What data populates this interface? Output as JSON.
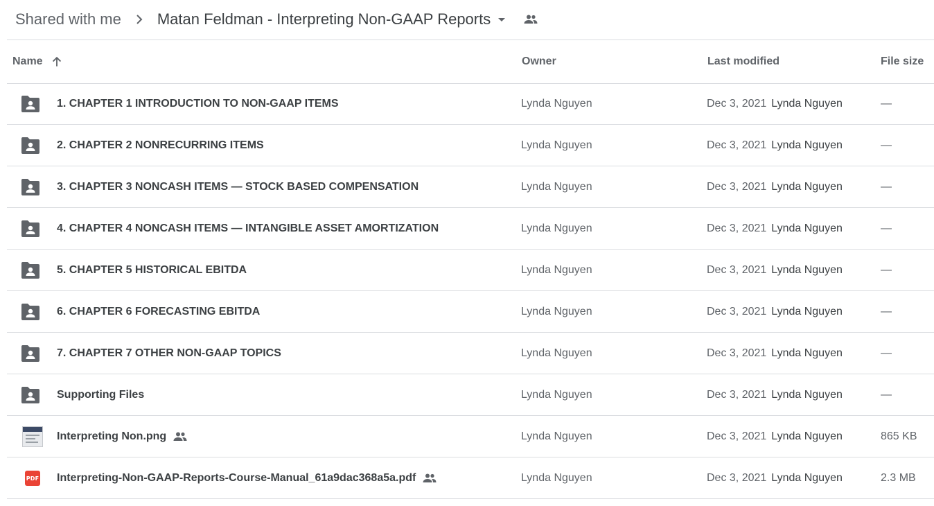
{
  "breadcrumb": {
    "root": "Shared with me",
    "current": "Matan Feldman - Interpreting Non-GAAP Reports"
  },
  "columns": {
    "name": "Name",
    "owner": "Owner",
    "last_modified": "Last modified",
    "file_size": "File size"
  },
  "sort": {
    "column": "name",
    "direction": "ascending",
    "icon": "arrow-up-icon"
  },
  "files": [
    {
      "type": "shared-folder",
      "name": "1. CHAPTER 1 INTRODUCTION TO NON-GAAP ITEMS",
      "owner": "Lynda Nguyen",
      "modified_date": "Dec 3, 2021",
      "modified_by": "Lynda Nguyen",
      "size": "—",
      "shared": false
    },
    {
      "type": "shared-folder",
      "name": "2. CHAPTER 2 NONRECURRING ITEMS",
      "owner": "Lynda Nguyen",
      "modified_date": "Dec 3, 2021",
      "modified_by": "Lynda Nguyen",
      "size": "—",
      "shared": false
    },
    {
      "type": "shared-folder",
      "name": "3. CHAPTER 3 NONCASH ITEMS — STOCK BASED COMPENSATION",
      "owner": "Lynda Nguyen",
      "modified_date": "Dec 3, 2021",
      "modified_by": "Lynda Nguyen",
      "size": "—",
      "shared": false
    },
    {
      "type": "shared-folder",
      "name": "4. CHAPTER 4 NONCASH ITEMS — INTANGIBLE ASSET AMORTIZATION",
      "owner": "Lynda Nguyen",
      "modified_date": "Dec 3, 2021",
      "modified_by": "Lynda Nguyen",
      "size": "—",
      "shared": false
    },
    {
      "type": "shared-folder",
      "name": "5. CHAPTER 5 HISTORICAL EBITDA",
      "owner": "Lynda Nguyen",
      "modified_date": "Dec 3, 2021",
      "modified_by": "Lynda Nguyen",
      "size": "—",
      "shared": false
    },
    {
      "type": "shared-folder",
      "name": "6. CHAPTER 6 FORECASTING EBITDA",
      "owner": "Lynda Nguyen",
      "modified_date": "Dec 3, 2021",
      "modified_by": "Lynda Nguyen",
      "size": "—",
      "shared": false
    },
    {
      "type": "shared-folder",
      "name": "7. CHAPTER 7 OTHER NON-GAAP TOPICS",
      "owner": "Lynda Nguyen",
      "modified_date": "Dec 3, 2021",
      "modified_by": "Lynda Nguyen",
      "size": "—",
      "shared": false
    },
    {
      "type": "shared-folder",
      "name": "Supporting Files",
      "owner": "Lynda Nguyen",
      "modified_date": "Dec 3, 2021",
      "modified_by": "Lynda Nguyen",
      "size": "—",
      "shared": false
    },
    {
      "type": "image",
      "name": "Interpreting Non.png",
      "owner": "Lynda Nguyen",
      "modified_date": "Dec 3, 2021",
      "modified_by": "Lynda Nguyen",
      "size": "865 KB",
      "shared": true
    },
    {
      "type": "pdf",
      "name": "Interpreting-Non-GAAP-Reports-Course-Manual_61a9dac368a5a.pdf",
      "owner": "Lynda Nguyen",
      "modified_date": "Dec 3, 2021",
      "modified_by": "Lynda Nguyen",
      "size": "2.3 MB",
      "shared": true,
      "badge": "PDF"
    }
  ],
  "colors": {
    "folder_icon": "#5f6368",
    "pdf_badge": "#ea4335",
    "divider": "#dadce0",
    "text_primary": "#3c4043",
    "text_secondary": "#5f6368"
  }
}
